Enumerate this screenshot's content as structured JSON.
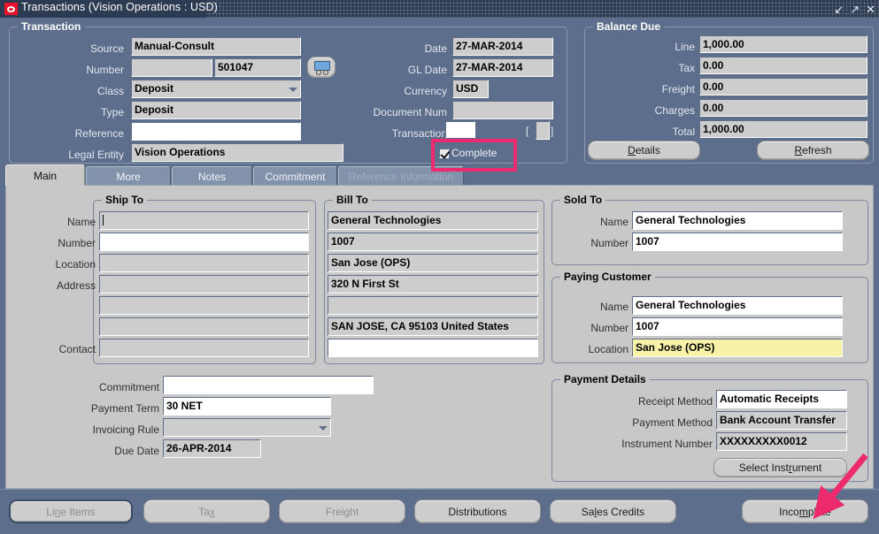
{
  "window": {
    "title": "Transactions (Vision Operations : USD)",
    "icon": "oracle-icon",
    "controls": {
      "restore": "↙",
      "maximize": "↗",
      "close": "✕"
    }
  },
  "transaction_group": {
    "title": "Transaction",
    "fields": {
      "source_label": "Source",
      "source_value": "Manual-Consult",
      "number_label": "Number",
      "number_prefix_value": "",
      "number_value": "501047",
      "class_label": "Class",
      "class_value": "Deposit",
      "type_label": "Type",
      "type_value": "Deposit",
      "reference_label": "Reference",
      "reference_value": "",
      "legal_entity_label": "Legal Entity",
      "legal_entity_value": "Vision Operations",
      "date_label": "Date",
      "date_value": "27-MAR-2014",
      "gl_date_label": "GL Date",
      "gl_date_value": "27-MAR-2014",
      "currency_label": "Currency",
      "currency_value": "USD",
      "document_num_label": "Document Num",
      "document_num_value": "",
      "transaction_label": "Transaction",
      "transaction_value": "",
      "transaction_bracket_open": "[",
      "transaction_bracket_close": "]",
      "transaction_flex_value": "",
      "complete_label": "Complete",
      "complete_checked": true
    }
  },
  "balance_due": {
    "title": "Balance Due",
    "rows": [
      {
        "label": "Line",
        "value": "1,000.00"
      },
      {
        "label": "Tax",
        "value": "0.00"
      },
      {
        "label": "Freight",
        "value": "0.00"
      },
      {
        "label": "Charges",
        "value": "0.00"
      },
      {
        "label": "Total",
        "value": "1,000.00"
      }
    ],
    "details_button": "Details",
    "refresh_button": "Refresh"
  },
  "tabs": [
    {
      "label": "Main",
      "active": true,
      "enabled": true
    },
    {
      "label": "More",
      "active": false,
      "enabled": true
    },
    {
      "label": "Notes",
      "active": false,
      "enabled": true
    },
    {
      "label": "Commitment",
      "active": false,
      "enabled": true
    },
    {
      "label": "Reference Information",
      "active": false,
      "enabled": false
    }
  ],
  "ship_to": {
    "title": "Ship To",
    "labels": {
      "name": "Name",
      "number": "Number",
      "location": "Location",
      "address": "Address",
      "contact": "Contact"
    },
    "values": {
      "name": "",
      "number": "",
      "location": "",
      "address1": "",
      "address2": "",
      "address3": "",
      "contact": ""
    }
  },
  "bill_to": {
    "title": "Bill To",
    "values": {
      "name": "General Technologies",
      "number": "1007",
      "location": "San Jose (OPS)",
      "address1": "320 N First St",
      "address2": "",
      "address3": "SAN JOSE, CA 95103 United States",
      "contact": ""
    }
  },
  "sold_to": {
    "title": "Sold To",
    "name_label": "Name",
    "name_value": "General Technologies",
    "number_label": "Number",
    "number_value": "1007"
  },
  "paying_customer": {
    "title": "Paying Customer",
    "name_label": "Name",
    "name_value": "General Technologies",
    "number_label": "Number",
    "number_value": "1007",
    "location_label": "Location",
    "location_value": "San Jose (OPS)",
    "location_highlight_color": "#f7f2a8"
  },
  "payment_details": {
    "title": "Payment Details",
    "receipt_method_label": "Receipt Method",
    "receipt_method_value": "Automatic Receipts",
    "payment_method_label": "Payment Method",
    "payment_method_value": "Bank Account Transfer",
    "instrument_number_label": "Instrument Number",
    "instrument_number_value": "XXXXXXXXX0012",
    "select_instrument_button": "Select Instrument"
  },
  "terms": {
    "commitment_label": "Commitment",
    "commitment_value": "",
    "payment_term_label": "Payment Term",
    "payment_term_value": "30 NET",
    "invoicing_rule_label": "Invoicing Rule",
    "invoicing_rule_value": "",
    "due_date_label": "Due Date",
    "due_date_value": "26-APR-2014"
  },
  "bottom_buttons": [
    {
      "label": "Line Items",
      "enabled": false,
      "focused": true
    },
    {
      "label": "Tax",
      "enabled": false,
      "focused": false
    },
    {
      "label": "Freight",
      "enabled": false,
      "focused": false
    },
    {
      "label": "Distributions",
      "enabled": true,
      "focused": false
    },
    {
      "label": "Sales Credits",
      "enabled": true,
      "focused": false
    },
    {
      "label": "Incomplete",
      "enabled": true,
      "focused": false
    }
  ],
  "annotations": {
    "highlight_color": "#ed2a6e",
    "complete_box": "complete-checkbox-highlight",
    "incomplete_arrow": "incomplete-button-arrow"
  },
  "colors": {
    "window_bg": "#5c6e8c",
    "titlebar": "#2c3a52",
    "panel_bg": "#c8c8c8",
    "field_bg": "#cdcdcd",
    "field_editable_bg": "#ffffff",
    "accent_red": "#e8132a"
  }
}
